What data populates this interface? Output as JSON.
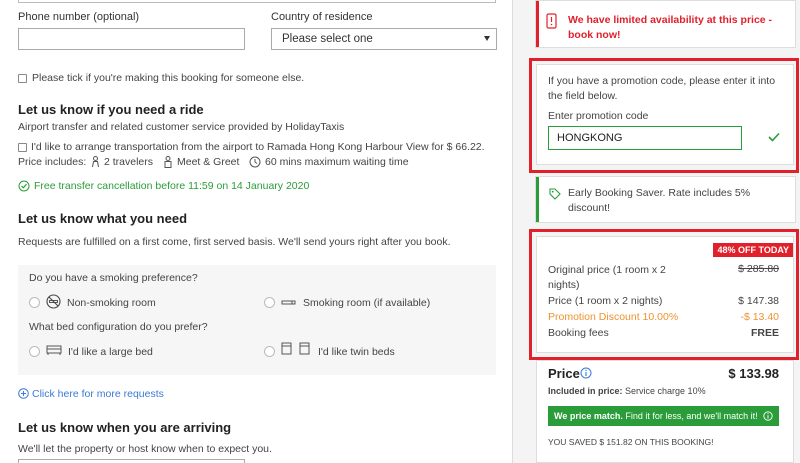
{
  "form": {
    "phone_label": "Phone number (optional)",
    "phone_value": "",
    "country_label": "Country of residence",
    "country_selected": "Please select one",
    "someone_else_label": "Please tick if you're making this booking for someone else."
  },
  "ride": {
    "heading": "Let us know if you need a ride",
    "subtitle": "Airport transfer and related customer service provided by HolidayTaxis",
    "option_label": "I'd like to arrange transportation from the airport to Ramada Hong Kong Harbour View for $ 66.22.",
    "includes_label": "Price includes:",
    "travelers": "2 travelers",
    "meet_greet": "Meet & Greet",
    "waiting": "60 mins maximum waiting time",
    "free_cancel": "Free transfer cancellation before 11:59 on 14 January 2020"
  },
  "needs": {
    "heading": "Let us know what you need",
    "subtitle": "Requests are fulfilled on a first come, first served basis. We'll send yours right after you book.",
    "smoking_question": "Do you have a smoking preference?",
    "non_smoking": "Non-smoking room",
    "smoking": "Smoking room (if available)",
    "bed_question": "What bed configuration do you prefer?",
    "large_bed": "I'd like a large bed",
    "twin_beds": "I'd like twin beds",
    "more_requests": "Click here for more requests"
  },
  "arrival": {
    "heading": "Let us know when you are arriving",
    "subtitle": "We'll let the property or host know when to expect you."
  },
  "sidebar": {
    "limited_availability": "We have limited availability at this price - book now!",
    "promo_intro": "If you have a promotion code, please enter it into the field below.",
    "promo_label": "Enter promotion code",
    "promo_value": "HONGKONG",
    "early_booking": "Early Booking Saver. Rate includes 5% discount!",
    "discount_badge": "48% OFF TODAY",
    "original_price_label": "Original price (1 room x 2 nights)",
    "original_price_value": "$ 285.80",
    "price_label": "Price (1 room x 2 nights)",
    "price_value": "$ 147.38",
    "promo_discount_label": "Promotion Discount 10.00%",
    "promo_discount_value": "-$ 13.40",
    "booking_fees_label": "Booking fees",
    "booking_fees_value": "FREE",
    "total_label": "Price",
    "total_value": "$ 133.98",
    "included_label": "Included in price:",
    "included_value": "Service charge 10%",
    "match_bold": "We price match.",
    "match_text": "Find it for less, and we'll match it!",
    "saved": "YOU SAVED $ 151.82 ON THIS BOOKING!"
  },
  "colors": {
    "accent_red": "#e0202a",
    "accent_green": "#2a9d3a",
    "link_blue": "#3a7bd5",
    "discount_orange": "#f0922c"
  }
}
